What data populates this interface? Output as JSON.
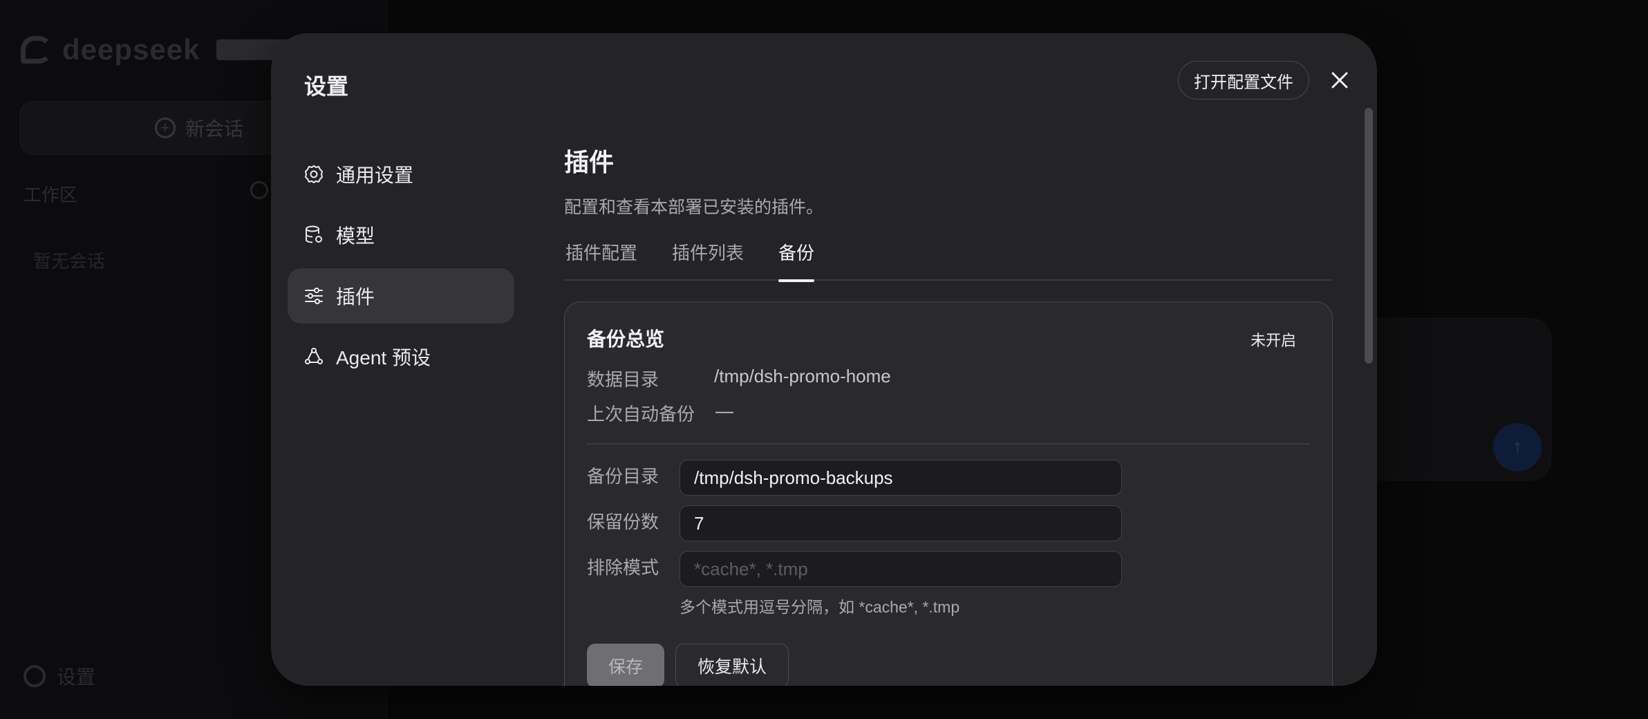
{
  "background": {
    "logo_text": "deepseek",
    "new_chat_label": "新会话",
    "workspace_label": "工作区",
    "empty_label": "暂无会话",
    "settings_label": "设置"
  },
  "modal": {
    "title": "设置",
    "open_config_label": "打开配置文件",
    "nav": [
      {
        "label": "通用设置",
        "icon": "gear-icon"
      },
      {
        "label": "模型",
        "icon": "database-icon"
      },
      {
        "label": "插件",
        "icon": "sliders-icon",
        "active": true
      },
      {
        "label": "Agent 预设",
        "icon": "agent-icon"
      }
    ]
  },
  "content": {
    "title": "插件",
    "description": "配置和查看本部署已安装的插件。",
    "tabs": [
      {
        "label": "插件配置"
      },
      {
        "label": "插件列表"
      },
      {
        "label": "备份",
        "active": true
      }
    ]
  },
  "backup": {
    "title": "备份总览",
    "status": "未开启",
    "data_dir_label": "数据目录",
    "data_dir_value": "/tmp/dsh-promo-home",
    "last_backup_label": "上次自动备份",
    "last_backup_value": "—",
    "backup_dir_label": "备份目录",
    "backup_dir_value": "/tmp/dsh-promo-backups",
    "retain_label": "保留份数",
    "retain_value": "7",
    "exclude_label": "排除模式",
    "exclude_placeholder": "*cache*, *.tmp",
    "exclude_hint": "多个模式用逗号分隔，如 *cache*, *.tmp",
    "save_label": "保存",
    "reset_label": "恢复默认"
  }
}
